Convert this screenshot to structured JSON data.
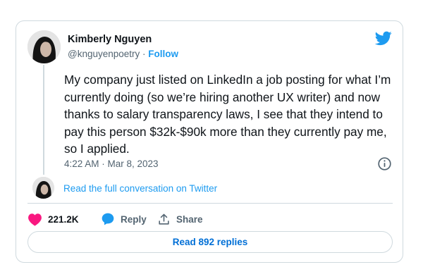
{
  "author": {
    "name": "Kimberly Nguyen",
    "handle": "@knguyenpoetry",
    "separator": " · ",
    "follow_label": "Follow"
  },
  "tweet": {
    "text": "My company just listed on LinkedIn a job posting for what I’m currently doing (so we’re hiring another UX writer) and now thanks to salary transparency laws, I see that they intend to pay this person $32k-$90k more than they currently pay me, so I applied.",
    "timestamp": "4:22 AM · Mar 8, 2023"
  },
  "conversation": {
    "link_label": "Read the full conversation on Twitter"
  },
  "actions": {
    "like_count": "221.2K",
    "reply_label": "Reply",
    "share_label": "Share"
  },
  "footer": {
    "read_replies_label": "Read 892 replies"
  },
  "icons": {
    "brand": "twitter-bird-icon",
    "info": "info-icon",
    "like": "heart-icon",
    "reply": "speech-bubble-icon",
    "share": "share-upload-icon"
  },
  "colors": {
    "accent": "#1d9bf0",
    "like": "#f91880",
    "text": "#0f1419",
    "muted": "#536471",
    "border": "#cfd9de",
    "read_replies_text": "#006fd6"
  }
}
